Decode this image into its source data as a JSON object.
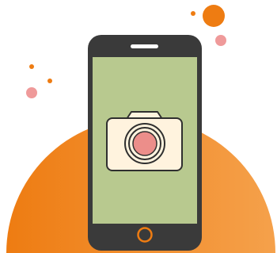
{
  "illustration": {
    "subject": "phone-camera-illustration",
    "icons": {
      "phone": "smartphone-icon",
      "camera": "camera-icon",
      "speaker": "speaker-slot-icon",
      "home_button": "home-button-icon"
    },
    "colors": {
      "background": "#ffffff",
      "backdrop_left": "#ee7c12",
      "backdrop_right": "#f5a14b",
      "phone_body": "#3a3a3a",
      "screen": "#b8c98f",
      "camera_body": "#fff3de",
      "camera_outline": "#2f2f2f",
      "lens_fill": "#ec8e8a",
      "home_button_outline": "#ee7c12",
      "speaker_slot": "#ffffff",
      "dot_orange": "#ee7c12",
      "dot_pink": "#ef9a9a"
    }
  }
}
